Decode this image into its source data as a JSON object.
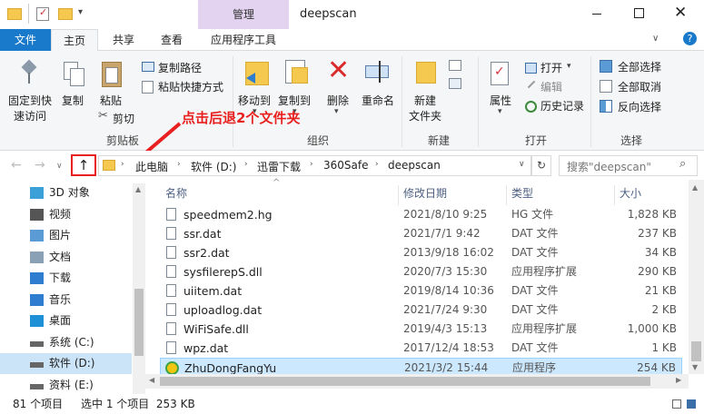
{
  "window": {
    "title": "deepscan",
    "context_tab": "管理"
  },
  "tabs": [
    "文件",
    "主页",
    "共享",
    "查看",
    "应用程序工具"
  ],
  "ribbon": {
    "pin_label_1": "固定到快",
    "pin_label_2": "速访问",
    "copy": "复制",
    "paste": "粘贴",
    "copy_path": "复制路径",
    "paste_shortcut": "粘贴快捷方式",
    "cut": "剪切",
    "clipboard_group": "剪贴板",
    "move_to": "移动到",
    "copy_to": "复制到",
    "delete": "删除",
    "rename": "重命名",
    "organize_group": "组织",
    "new_folder_1": "新建",
    "new_folder_2": "文件夹",
    "new_group": "新建",
    "properties": "属性",
    "open": "打开",
    "edit": "编辑",
    "history": "历史记录",
    "open_group": "打开",
    "select_all": "全部选择",
    "select_none": "全部取消",
    "invert_selection": "反向选择",
    "select_group": "选择"
  },
  "annotation": "点击后退2个文件夹",
  "address": {
    "segments": [
      "此电脑",
      "软件 (D:)",
      "迅雷下载",
      "360Safe",
      "deepscan"
    ],
    "search_placeholder": "搜索\"deepscan\""
  },
  "nav": [
    {
      "label": "3D 对象",
      "icon": "cube-icon"
    },
    {
      "label": "视频",
      "icon": "video-icon"
    },
    {
      "label": "图片",
      "icon": "picture-icon"
    },
    {
      "label": "文档",
      "icon": "document-icon"
    },
    {
      "label": "下载",
      "icon": "download-icon"
    },
    {
      "label": "音乐",
      "icon": "music-icon"
    },
    {
      "label": "桌面",
      "icon": "desktop-icon"
    },
    {
      "label": "系统 (C:)",
      "icon": "drive-icon"
    },
    {
      "label": "软件 (D:)",
      "icon": "drive-icon"
    },
    {
      "label": "资料 (E:)",
      "icon": "drive-icon"
    }
  ],
  "columns": [
    "名称",
    "修改日期",
    "类型",
    "大小"
  ],
  "files": [
    [
      "speedmem2.hg",
      "2021/8/10 9:25",
      "HG 文件",
      "1,828 KB"
    ],
    [
      "ssr.dat",
      "2021/7/1 9:42",
      "DAT 文件",
      "237 KB"
    ],
    [
      "ssr2.dat",
      "2013/9/18 16:02",
      "DAT 文件",
      "34 KB"
    ],
    [
      "sysfilerepS.dll",
      "2020/7/3 15:30",
      "应用程序扩展",
      "290 KB"
    ],
    [
      "uiitem.dat",
      "2019/8/14 10:36",
      "DAT 文件",
      "21 KB"
    ],
    [
      "uploadlog.dat",
      "2021/7/24 9:30",
      "DAT 文件",
      "2 KB"
    ],
    [
      "WiFiSafe.dll",
      "2019/4/3 15:13",
      "应用程序扩展",
      "1,000 KB"
    ],
    [
      "wpz.dat",
      "2017/12/4 18:53",
      "DAT 文件",
      "1 KB"
    ],
    [
      "ZhuDongFangYu",
      "2021/3/2 15:44",
      "应用程序",
      "254 KB"
    ]
  ],
  "status": {
    "count": "81 个项目",
    "selected": "选中 1 个项目  253 KB"
  }
}
